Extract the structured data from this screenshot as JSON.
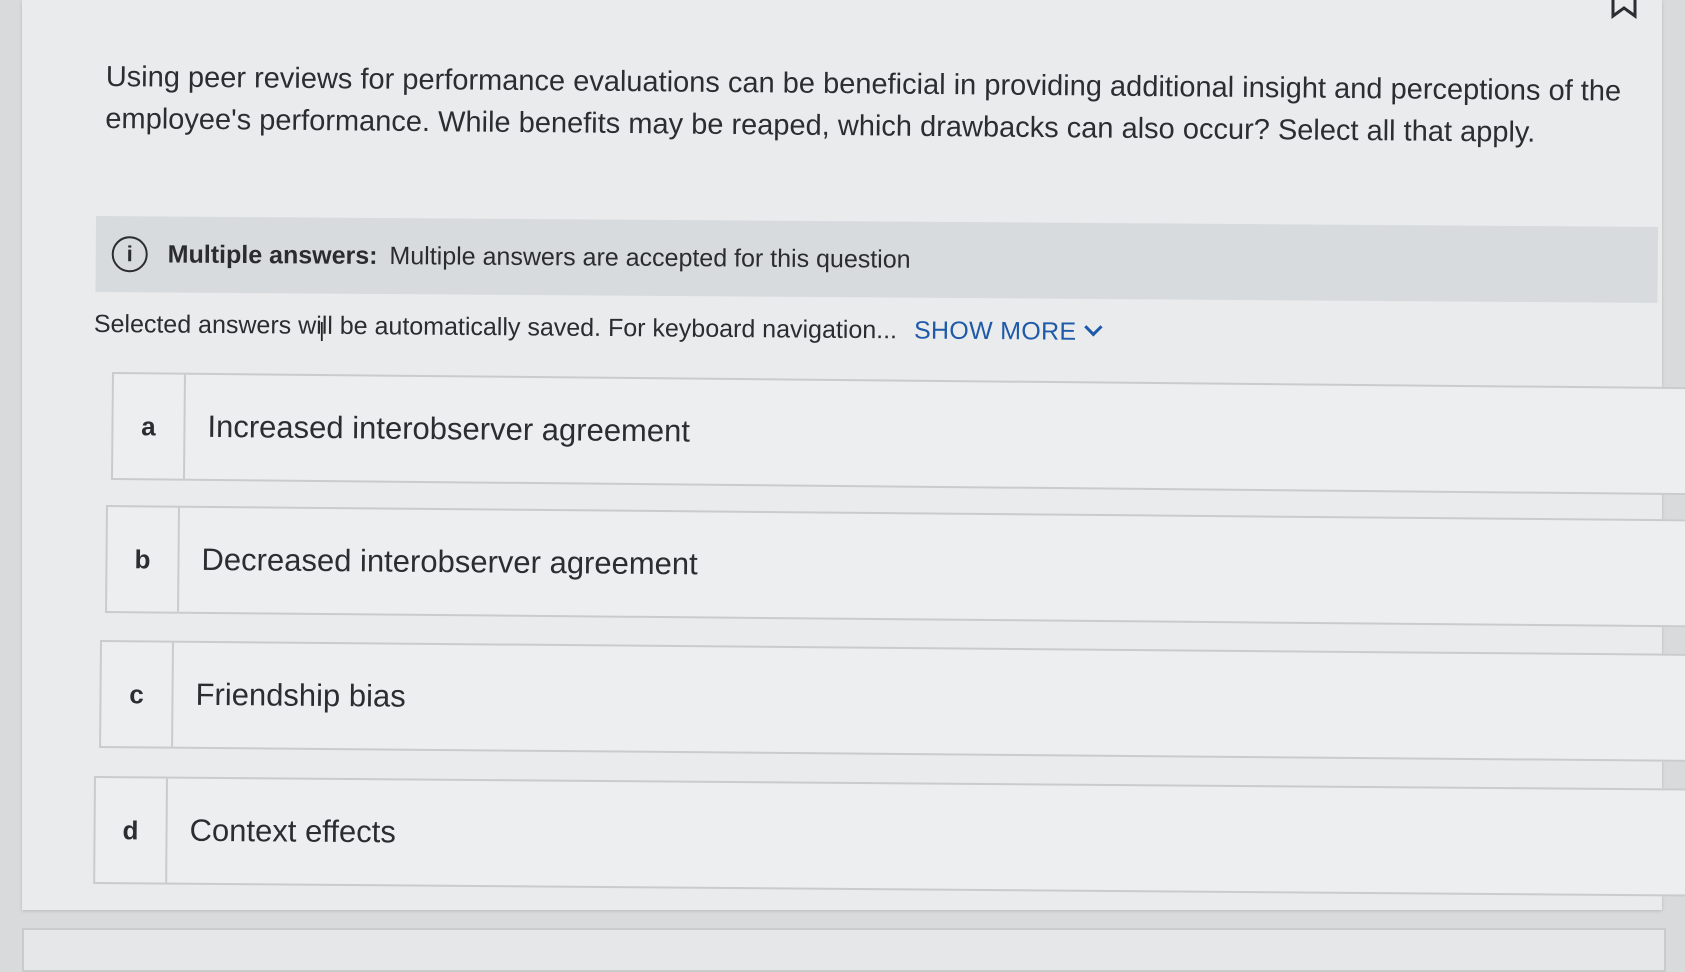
{
  "question": {
    "text": "Using peer reviews for performance evaluations can be beneficial in providing additional insight and perceptions of the employee's performance. While benefits may be reaped, which drawbacks can also occur? Select all that apply."
  },
  "notice": {
    "icon": "info-icon",
    "title": "Multiple answers:",
    "text": "Multiple answers are accepted for this question"
  },
  "hint": {
    "text": "Selected answers will be automatically saved. For keyboard navigation...",
    "show_more": "SHOW MORE",
    "show_more_icon": "chevron-down-icon"
  },
  "options": [
    {
      "letter": "a",
      "text": "Increased interobserver agreement"
    },
    {
      "letter": "b",
      "text": "Decreased interobserver agreement"
    },
    {
      "letter": "c",
      "text": "Friendship bias"
    },
    {
      "letter": "d",
      "text": "Context effects"
    }
  ],
  "colors": {
    "link": "#1d5aa8",
    "notice_bg": "#d7dbde",
    "card_bg": "#eaebec"
  }
}
